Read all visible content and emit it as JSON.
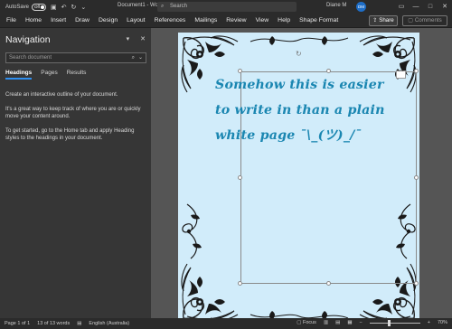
{
  "titlebar": {
    "autosave_label": "AutoSave",
    "autosave_state": "Off",
    "doc_title": "Document1 - Word",
    "search_placeholder": "Search",
    "user_name": "Diane M",
    "user_initials": "DM"
  },
  "menu": {
    "items": [
      "File",
      "Home",
      "Insert",
      "Draw",
      "Design",
      "Layout",
      "References",
      "Mailings",
      "Review",
      "View",
      "Help",
      "Shape Format"
    ],
    "share_label": "Share",
    "comments_label": "Comments"
  },
  "nav": {
    "title": "Navigation",
    "search_placeholder": "Search document",
    "tabs": [
      "Headings",
      "Pages",
      "Results"
    ],
    "active_tab": "Headings",
    "body": [
      "Create an interactive outline of your document.",
      "It's a great way to keep track of where you are or quickly move your content around.",
      "To get started, go to the Home tab and apply Heading styles to the headings in your document."
    ]
  },
  "document": {
    "text": "Somehow this is easier to write in than a plain white page ¯\\_(ツ)_/¯",
    "text_color": "#1a86b1",
    "page_color": "#d1ecfa"
  },
  "status": {
    "page": "Page 1 of 1",
    "words": "13 of 13 words",
    "language": "English (Australia)",
    "focus": "Focus",
    "zoom": "70%"
  },
  "colors": {
    "chrome": "#2b2b2b",
    "nav_bg": "#363636",
    "canvas": "#555555",
    "accent": "#2f8ff0",
    "avatar": "#1e6ec8"
  }
}
